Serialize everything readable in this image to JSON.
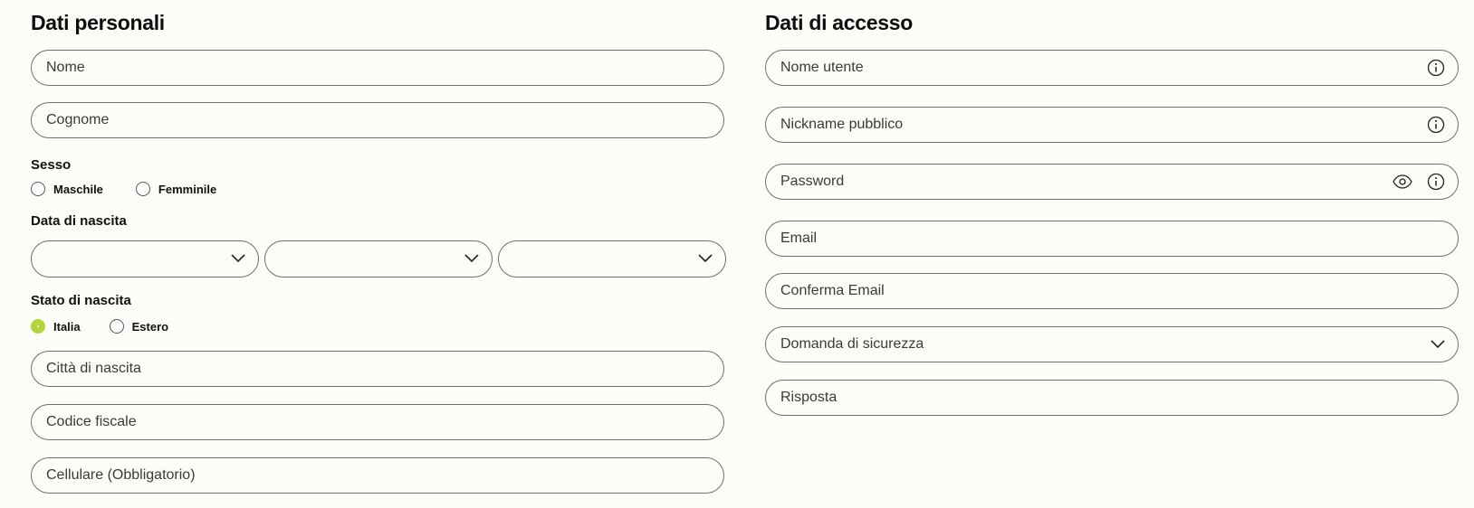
{
  "personal": {
    "title": "Dati personali",
    "fields": {
      "nome": "Nome",
      "cognome": "Cognome",
      "citta": "Città di nascita",
      "codice_fiscale": "Codice fiscale",
      "cellulare": "Cellulare (Obbligatorio)"
    },
    "sesso": {
      "label": "Sesso",
      "options": [
        "Maschile",
        "Femminile"
      ],
      "selected": null
    },
    "data_nascita": {
      "label": "Data di nascita",
      "day": "",
      "month": "",
      "year": ""
    },
    "stato_nascita": {
      "label": "Stato di nascita",
      "options": [
        "Italia",
        "Estero"
      ],
      "selected": "Italia"
    }
  },
  "access": {
    "title": "Dati di accesso",
    "fields": {
      "nome_utente": "Nome utente",
      "nickname": "Nickname pubblico",
      "password": "Password",
      "email": "Email",
      "conferma_email": "Conferma Email",
      "domanda": "Domanda di sicurezza",
      "risposta": "Risposta"
    }
  },
  "colors": {
    "accent": "#b5d33b",
    "border": "#6f6f6f",
    "background": "#fdfcf8"
  },
  "icons": {
    "info": "info-icon",
    "eye": "eye-icon",
    "chevron": "chevron-down-icon"
  }
}
